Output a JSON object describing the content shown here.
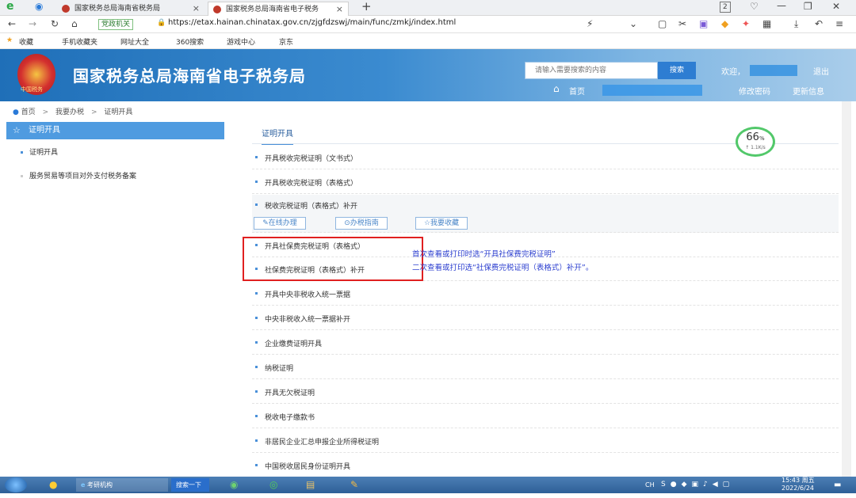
{
  "browser": {
    "tabs": [
      {
        "label": "国家税务总局海南省税务局",
        "close": "×"
      },
      {
        "label": "国家税务总局海南省电子税务",
        "close": "×"
      }
    ],
    "new_tab": "+",
    "tab_count": "2",
    "address": {
      "badge": "党政机关",
      "url": "https://etax.hainan.chinatax.gov.cn/zjgfdzswj/main/func/zmkj/index.html"
    },
    "bookmarks": [
      "收藏",
      "手机收藏夹",
      "网址大全",
      "360搜索",
      "游戏中心",
      "京东"
    ]
  },
  "header": {
    "title": "国家税务总局海南省电子税务局",
    "emblem_text": "中国税务",
    "search_placeholder": "请输入需要搜索的内容",
    "search_button": "搜索",
    "welcome": "欢迎，",
    "logout": "退出",
    "home": "首页",
    "change_password": "修改密码",
    "update_info": "更新信息"
  },
  "breadcrumb": [
    "首页",
    "我要办税",
    "证明开具"
  ],
  "breadcrumb_sep": ">",
  "sidebar": {
    "header": "证明开具",
    "items": [
      "证明开具",
      "服务贸易等项目对外支付税务备案"
    ]
  },
  "main": {
    "tab": "证明开具",
    "items": [
      "开具税收完税证明（文书式）",
      "开具税收完税证明（表格式）",
      "税收完税证明（表格式）补开",
      "开具社保费完税证明（表格式）",
      "社保费完税证明（表格式）补开",
      "开具中央非税收入统一票据",
      "中央非税收入统一票据补开",
      "企业缴费证明开具",
      "纳税证明",
      "开具无欠税证明",
      "税收电子缴款书",
      "非居民企业汇总申报企业所得税证明",
      "中国税收居民身份证明开具"
    ],
    "actions": [
      "在线办理",
      "办税指南",
      "我要收藏"
    ],
    "notes": [
      "首次查看或打印时选“开具社保费完税证明”",
      "二次查看或打印选“社保费完税证明（表格式）补开”。"
    ]
  },
  "speed_widget": {
    "percent": "66",
    "unit": "%",
    "rate": "↑ 1.1K/s"
  },
  "taskbar": {
    "items": [
      "考研机构",
      "搜索一下"
    ],
    "lang": "CH",
    "time": "15:43 周五",
    "date": "2022/6/24"
  }
}
